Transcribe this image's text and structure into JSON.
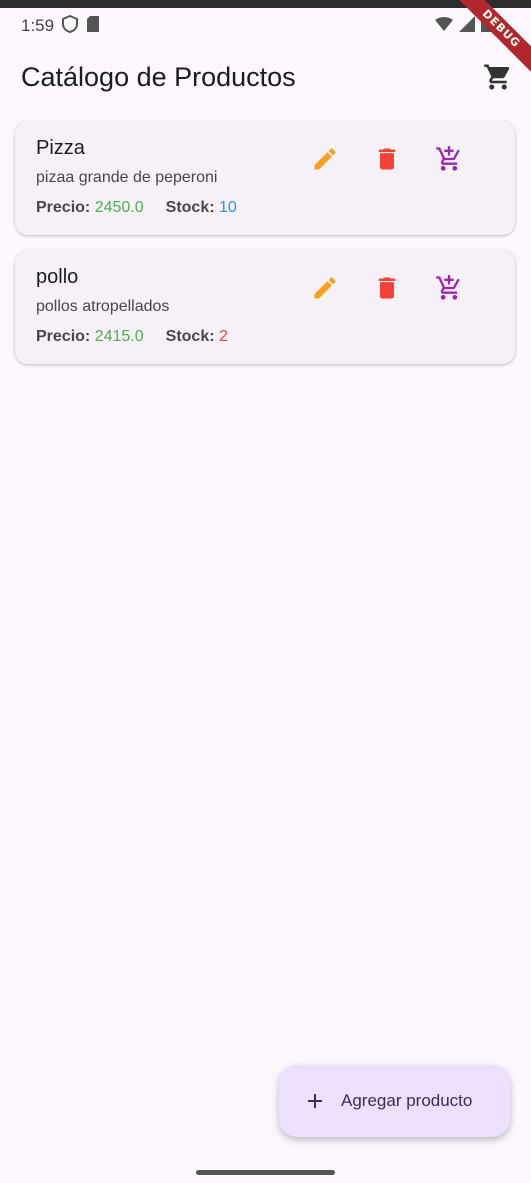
{
  "status_bar": {
    "time": "1:59",
    "debug_label": "DEBUG"
  },
  "app_bar": {
    "title": "Catálogo de Productos"
  },
  "labels": {
    "price": "Precio:",
    "stock": "Stock:"
  },
  "products": [
    {
      "name": "Pizza",
      "description": "pizaa grande de peperoni",
      "price": "2450.0",
      "stock": "10",
      "stock_status": "ok"
    },
    {
      "name": "pollo",
      "description": "pollos atropellados",
      "price": "2415.0",
      "stock": "2",
      "stock_status": "low"
    }
  ],
  "fab": {
    "label": "Agregar producto"
  },
  "colors": {
    "edit": "#f9a01b",
    "delete": "#f44336",
    "add_cart": "#9c27b0",
    "price": "#4caf50",
    "stock_ok": "#2196f3",
    "stock_low": "#f44336",
    "background": "#fdf7fe"
  },
  "icons": {
    "edit": "pencil-icon",
    "delete": "trash-icon",
    "add_cart": "add-shopping-cart-icon",
    "cart": "shopping-cart-icon",
    "fab": "plus-icon"
  }
}
